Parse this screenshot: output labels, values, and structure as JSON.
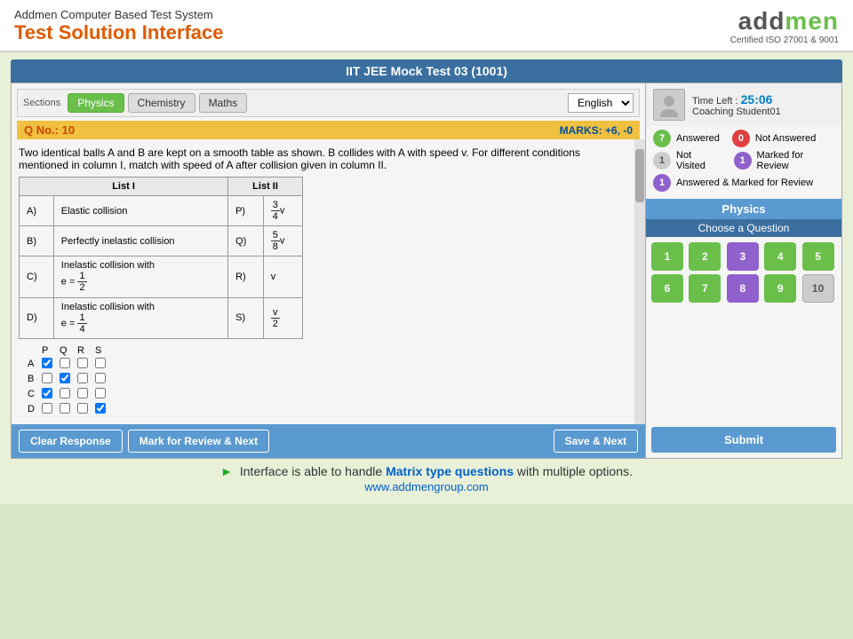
{
  "header": {
    "app_title_small": "Addmen Computer Based Test System",
    "app_title_big": "Test Solution Interface",
    "logo_text": "addmen",
    "logo_subtitle": "Certified ISO 27001 & 9001"
  },
  "test": {
    "title": "IIT JEE Mock Test 03 (1001)"
  },
  "sections": {
    "label": "Sections",
    "tabs": [
      {
        "label": "Physics",
        "active": true
      },
      {
        "label": "Chemistry",
        "active": false
      },
      {
        "label": "Maths",
        "active": false
      }
    ],
    "language": "English"
  },
  "question": {
    "number_label": "Q No.: 10",
    "marks_label": "MARKS: +6, -0",
    "text": "Two identical balls A and B are kept on a smooth table as shown. B collides with A with speed v. For different conditions mentioned in column I, match with speed of A after collision given in column II.",
    "table": {
      "col1": "List I",
      "col2": "List II",
      "rows": [
        {
          "id": "A)",
          "col1": "Elastic collision",
          "id2": "P)",
          "col2_frac": {
            "num": "3",
            "den": "4",
            "suffix": "v"
          }
        },
        {
          "id": "B)",
          "col1": "Perfectly inelastic collision",
          "id2": "Q)",
          "col2_frac": {
            "num": "5",
            "den": "8",
            "suffix": "v"
          }
        },
        {
          "id": "C)",
          "col1": "Inelastic collision with e = 1/2",
          "id2": "R)",
          "col2": "v"
        },
        {
          "id": "D)",
          "col1": "Inelastic collision with e = 1/4",
          "id2": "S)",
          "col2_frac": {
            "num": "v",
            "den": "2",
            "suffix": ""
          }
        }
      ]
    },
    "checkbox_header": [
      "P",
      "Q",
      "R",
      "S"
    ],
    "checkbox_rows": [
      {
        "label": "A",
        "checks": [
          true,
          false,
          false,
          false
        ]
      },
      {
        "label": "B",
        "checks": [
          false,
          true,
          false,
          false
        ]
      },
      {
        "label": "C",
        "checks": [
          true,
          false,
          false,
          false
        ]
      },
      {
        "label": "D",
        "checks": [
          false,
          false,
          false,
          true
        ]
      }
    ]
  },
  "buttons": {
    "clear_response": "Clear Response",
    "mark_review": "Mark for Review & Next",
    "save_next": "Save & Next",
    "submit": "Submit"
  },
  "right_panel": {
    "time_left_label": "Time Left :",
    "time_left_value": "25:06",
    "student_name": "Coaching Student01",
    "legend": [
      {
        "badge_class": "badge-answered",
        "count": "7",
        "label": "Answered"
      },
      {
        "badge_class": "badge-not-answered",
        "count": "0",
        "label": "Not Answered"
      },
      {
        "badge_class": "badge-not-visited",
        "count": "1",
        "label": "Not Visited"
      },
      {
        "badge_class": "badge-marked",
        "count": "1",
        "label": "Marked for Review"
      },
      {
        "badge_class": "badge-answered-marked",
        "count": "1",
        "label": "Answered & Marked for Review"
      }
    ],
    "section_label": "Physics",
    "choose_q_label": "Choose a Question",
    "questions": [
      {
        "num": "1",
        "state": "answered"
      },
      {
        "num": "2",
        "state": "answered"
      },
      {
        "num": "3",
        "state": "marked"
      },
      {
        "num": "4",
        "state": "answered"
      },
      {
        "num": "5",
        "state": "answered"
      },
      {
        "num": "6",
        "state": "answered"
      },
      {
        "num": "7",
        "state": "answered"
      },
      {
        "num": "8",
        "state": "marked"
      },
      {
        "num": "9",
        "state": "answered"
      },
      {
        "num": "10",
        "state": "not-visited"
      }
    ]
  },
  "footer": {
    "text_part1": "Interface is able to handle ",
    "text_highlight": "Matrix type questions",
    "text_part2": " with multiple options.",
    "url": "www.addmengroup.com"
  }
}
